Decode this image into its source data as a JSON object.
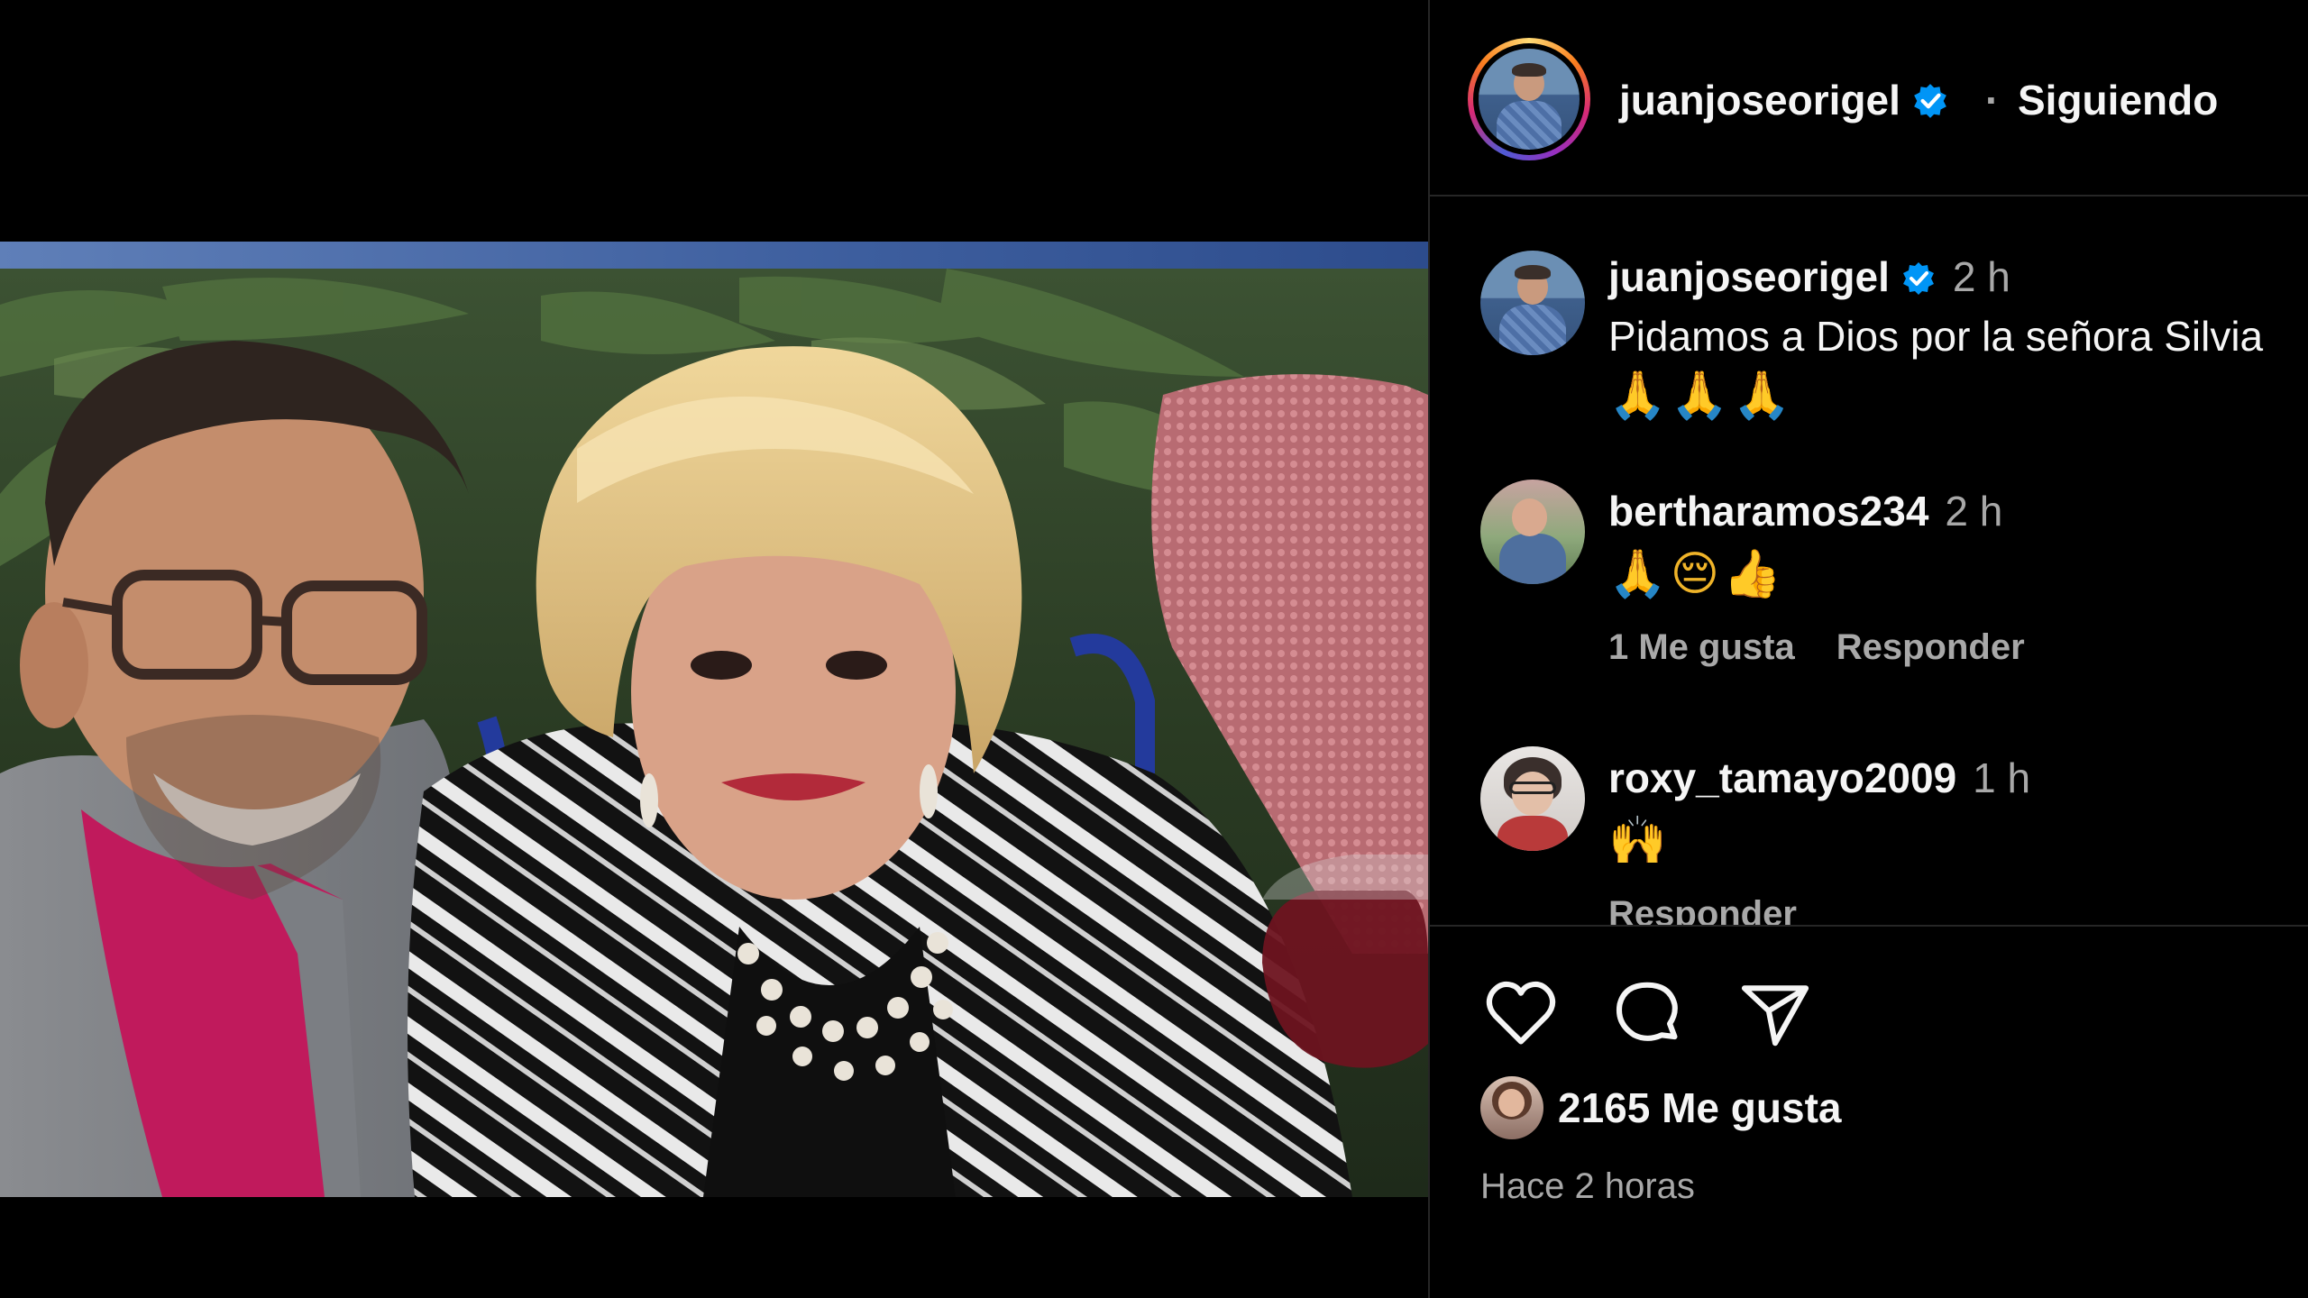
{
  "post": {
    "author": "juanjoseorigel",
    "follow_status": "Siguiendo",
    "separator": "·",
    "image_alt": "Selfie of a man with glasses and an older woman with blonde hair"
  },
  "comments": [
    {
      "user": "juanjoseorigel",
      "time": "2 h",
      "text": "Pidamos a Dios por la señora Silvia",
      "emoji": "🙏🙏🙏",
      "likes": "",
      "reply": ""
    },
    {
      "user": "berthar­amos234",
      "time": "2 h",
      "text": "",
      "emoji": "🙏😔👍",
      "likes": "1 Me gusta",
      "reply": "Responder"
    },
    {
      "user": "roxy_tamayo2009",
      "time": "1 h",
      "text": "",
      "emoji": "🙌",
      "likes": "",
      "reply": "Responder"
    }
  ],
  "actions": {
    "like_icon": "heart-icon",
    "comment_icon": "comment-icon",
    "share_icon": "send-icon"
  },
  "likes_count": "2165 Me gusta",
  "posted_ago": "Hace 2 horas",
  "colors": {
    "background": "#000000",
    "text": "#f5f5f5",
    "secondary": "#a8a8a8",
    "verified": "#0095f6",
    "divider": "#262626"
  }
}
